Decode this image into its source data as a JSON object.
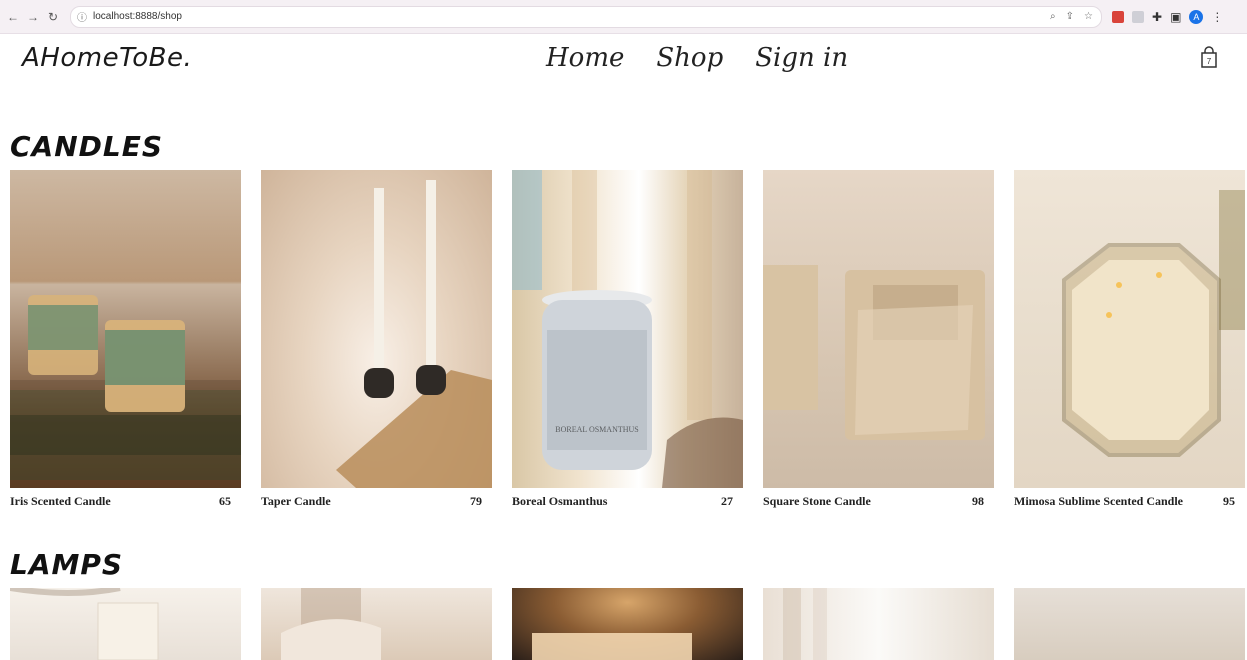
{
  "browser": {
    "nav": {
      "back_icon": "arrow-left-icon",
      "forward_icon": "arrow-right-icon",
      "reload_icon": "reload-icon"
    },
    "url_info_icon": "info-icon",
    "url": "localhost:8888/shop"
  },
  "site": {
    "logo": "AHomeToBe.",
    "nav": [
      "Home",
      "Shop",
      "Sign in"
    ],
    "cart_badge": "7"
  },
  "sections": {
    "candles_title": "CANDLES",
    "lamps_title": "LAMPS"
  },
  "candles": [
    {
      "name": "Iris Scented Candle",
      "price": "65"
    },
    {
      "name": "Taper Candle",
      "price": "79"
    },
    {
      "name": "Boreal Osmanthus",
      "price": "27"
    },
    {
      "name": "Square Stone Candle",
      "price": "98"
    },
    {
      "name": "Mimosa Sublime Scented Candle",
      "price": "95"
    }
  ],
  "image_text": {
    "boreal_label": "BOREAL OSMANTHUS"
  }
}
